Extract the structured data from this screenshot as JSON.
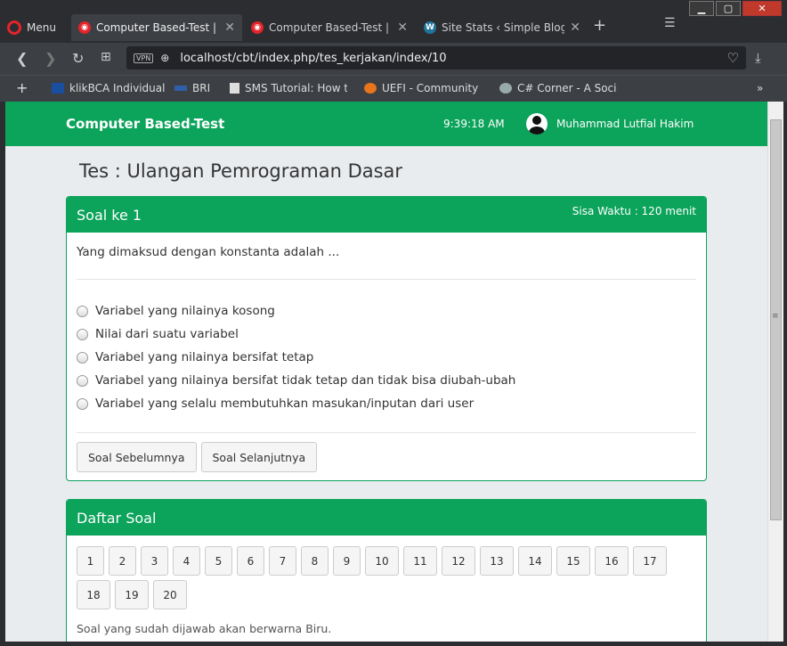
{
  "browser": {
    "menu_label": "Menu",
    "tabs": [
      {
        "label": "Computer Based-Test | Ker"
      },
      {
        "label": "Computer Based-Test | Ha"
      },
      {
        "label": "Site Stats ‹ Simple Blogs…"
      }
    ],
    "url": "localhost/cbt/index.php/tes_kerjakan/index/10",
    "vpn_label": "VPN",
    "bookmarks": [
      {
        "label": "klikBCA Individual"
      },
      {
        "label": "BRI"
      },
      {
        "label": "SMS Tutorial: How to"
      },
      {
        "label": "UEFI - Community H"
      },
      {
        "label": "C# Corner - A Social"
      }
    ]
  },
  "navbar": {
    "brand": "Computer Based-Test",
    "time": "9:39:18 AM",
    "user": "Muhammad Lutfial Hakim"
  },
  "page": {
    "title": "Tes : Ulangan Pemrograman Dasar"
  },
  "question_panel": {
    "heading": "Soal ke 1",
    "timer": "Sisa Waktu : 120 menit",
    "question": "Yang dimaksud dengan konstanta adalah ...",
    "options": [
      "Variabel yang nilainya kosong",
      "Nilai dari suatu variabel",
      "Variabel yang nilainya bersifat tetap",
      "Variabel yang nilainya bersifat tidak tetap dan tidak bisa diubah-ubah",
      "Variabel yang selalu membutuhkan masukan/inputan dari user"
    ],
    "prev_label": "Soal Sebelumnya",
    "next_label": "Soal Selanjutnya"
  },
  "list_panel": {
    "heading": "Daftar Soal",
    "numbers": [
      "1",
      "2",
      "3",
      "4",
      "5",
      "6",
      "7",
      "8",
      "9",
      "10",
      "11",
      "12",
      "13",
      "14",
      "15",
      "16",
      "17",
      "18",
      "19",
      "20"
    ],
    "note": "Soal yang sudah dijawab akan berwarna Biru."
  },
  "colors": {
    "accent": "#0ca35b"
  }
}
